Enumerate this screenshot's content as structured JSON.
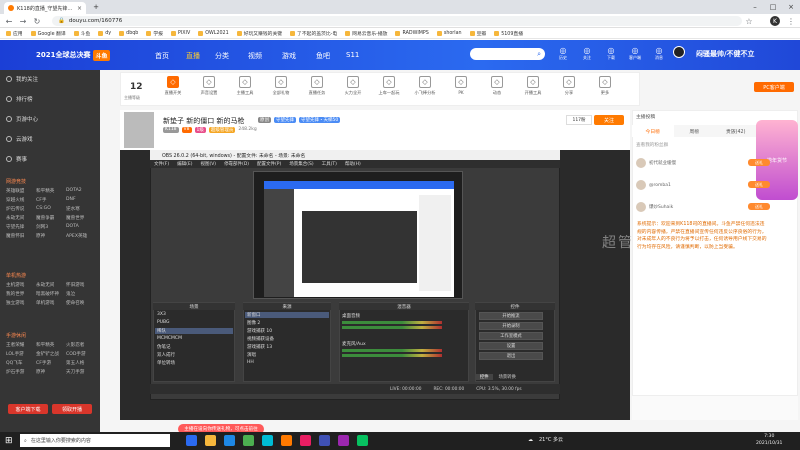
{
  "browser": {
    "tab_title": "K118的直播_守望先锋直播_斗鱼",
    "url": "douyu.com/160776",
    "bookmarks": [
      "应用",
      "Google 翻译",
      "斗鱼",
      "dy",
      "dbqb",
      "学报",
      "PIXIV",
      "OWL2021",
      "好玩又赚钱的关键",
      "了不起的盖茨比-电",
      "网易云音乐-播放",
      "RADWIMPS",
      "shorlan",
      "豆瓣",
      "5109直播"
    ]
  },
  "site": {
    "logo_text": "2021全球总决赛",
    "logo_badge": "斗鱼",
    "nav": [
      "首页",
      "直播",
      "分类",
      "视频",
      "游戏",
      "鱼吧",
      "S11"
    ],
    "nav_active_index": 1,
    "header_icons": [
      "历史",
      "关注",
      "下载",
      "客户端",
      "消息"
    ],
    "username": "闷骚最帅/不健不立"
  },
  "sidebar": {
    "items": [
      "我的关注",
      "排行榜",
      "页游中心",
      "云游戏",
      "赛事"
    ],
    "categories": [
      {
        "title": "网游竞技",
        "games": [
          "英雄联盟",
          "和平精英",
          "DOTA2",
          "穿越火线",
          "CF手",
          "DNF",
          "炉石传说",
          "CS:GO",
          "逆水寒",
          "永劫无间",
          "魔兽争霸",
          "魔兽世界",
          "守望先锋",
          "剑网3",
          "DOTA",
          "魔兽怀旧",
          "原神",
          "APEX英雄"
        ]
      },
      {
        "title": "单机热游",
        "games": [
          "主机游戏",
          "永劫无间",
          "怀旧游戏",
          "我的世界",
          "暗黑破坏神",
          "鬼泣",
          "独立游戏",
          "单机游戏",
          "使命召唤"
        ]
      },
      {
        "title": "手游休闲",
        "games": [
          "王者荣耀",
          "和平精英",
          "火影忍者",
          "LOL手游",
          "金铲铲之战",
          "COD手游",
          "QQ飞车",
          "CF手游",
          "第五人格",
          "炉石手游",
          "原神",
          "天刀手游"
        ]
      }
    ],
    "btn_left": "客户端下载",
    "btn_right": "领取开播"
  },
  "toolbar": {
    "level": "12",
    "level_label": "主播等级",
    "items": [
      "直播开关",
      "声音设置",
      "主播工具",
      "全部礼物",
      "直播任务",
      "火力全开",
      "上车一起玩",
      "小飞棒分析",
      "PK",
      "动态",
      "开播工具",
      "分享",
      "更多"
    ],
    "pc_button": "PC客户端"
  },
  "streamer": {
    "title": "新垫子 新的僵口 新的马枪",
    "category_tags": [
      "原创",
      "守望先锋",
      "守望先锋・天梯50"
    ],
    "room": "K118",
    "tags": [
      "V8",
      "1级",
      "超级管理员"
    ],
    "fans": "248.2kg",
    "follow_count": "117粉",
    "follow_label": "关注"
  },
  "obs": {
    "title": "OBS 26.0.2 (64-bit, windows) - 配置文件: 未命名 - 场景: 未命名",
    "menu": [
      "文件(F)",
      "编辑(E)",
      "视图(V)",
      "停靠部件(D)",
      "配置文件(P)",
      "场景集合(S)",
      "工具(T)",
      "帮助(H)"
    ],
    "panels": {
      "scenes": {
        "title": "场景",
        "rows": [
          "3X3",
          "PUBG",
          "稀队",
          "MCMCMCM",
          "伪笔记",
          "双人成行",
          "单位转场"
        ],
        "selected": 2
      },
      "sources": {
        "title": "来源",
        "rows": [
          "新窗口",
          "图像 2",
          "游戏捕获 10",
          "视频捕获设备",
          "游戏捕获 13",
          "演唱",
          "HH"
        ],
        "selected": 0
      },
      "mixer": {
        "title": "混音器",
        "rows": [
          "桌面音频",
          "麦克风/Aux"
        ]
      },
      "controls": {
        "title": "控件",
        "buttons": [
          "开始推流",
          "开始录制",
          "工作室模式",
          "设置",
          "退出"
        ]
      }
    },
    "tabs": [
      "控件",
      "场景转换"
    ],
    "status": [
      "LIVE: 00:00:00",
      "REC: 00:00:00",
      "CPU: 3.5%, 30.00 fps"
    ]
  },
  "chat": {
    "anchor_label": "主播投稿",
    "tabs": [
      "今日榜",
      "周榜",
      "贵族(42)",
      "粉丝(0)"
    ],
    "fan_header": "查看我的粉丝群",
    "fans": [
      {
        "name": "初代就业缓慢",
        "action": "送礼"
      },
      {
        "name": "@romba1",
        "action": "送礼"
      },
      {
        "name": "爆炒Suhaik",
        "action": "送礼"
      }
    ],
    "system_message": "系统提示：欢迎来到K118司的直播间。斗鱼严禁任何违法违规的内容传播，严禁在直播间宣传任何违反公序良俗的行为，对未成年人的不良行为将予以打击，任何诱导用户线下交易的行为均存在风险，请谨慎判断，以防上当受骗。",
    "promo": "捞年货节",
    "watermark": "超管"
  },
  "gift_banner": "主播在设向你传送礼物，可点击前往",
  "taskbar": {
    "search_placeholder": "在这里输入你要搜索的内容",
    "weather": "21°C 多云",
    "time": "7:30",
    "date": "2021/10/31"
  }
}
